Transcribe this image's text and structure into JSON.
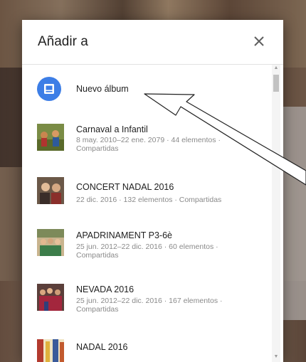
{
  "dialog": {
    "title": "Añadir a",
    "close_icon": "close-icon"
  },
  "new_album": {
    "label": "Nuevo álbum",
    "icon": "photo-album-icon",
    "color": "#3d7ee6"
  },
  "albums": [
    {
      "name": "Carnaval a Infantil",
      "meta": "8 may. 2010–22 ene. 2079 · 44 elementos · Compartidas"
    },
    {
      "name": "CONCERT NADAL 2016",
      "meta": "22 dic. 2016 · 132 elementos · Compartidas"
    },
    {
      "name": "APADRINAMENT P3-6è",
      "meta": "25 jun. 2012–22 dic. 2016 · 60 elementos · Compartidas"
    },
    {
      "name": "NEVADA 2016",
      "meta": "25 jun. 2012–22 dic. 2016 · 167 elementos · Compartidas"
    },
    {
      "name": "NADAL 2016",
      "meta": ""
    }
  ]
}
